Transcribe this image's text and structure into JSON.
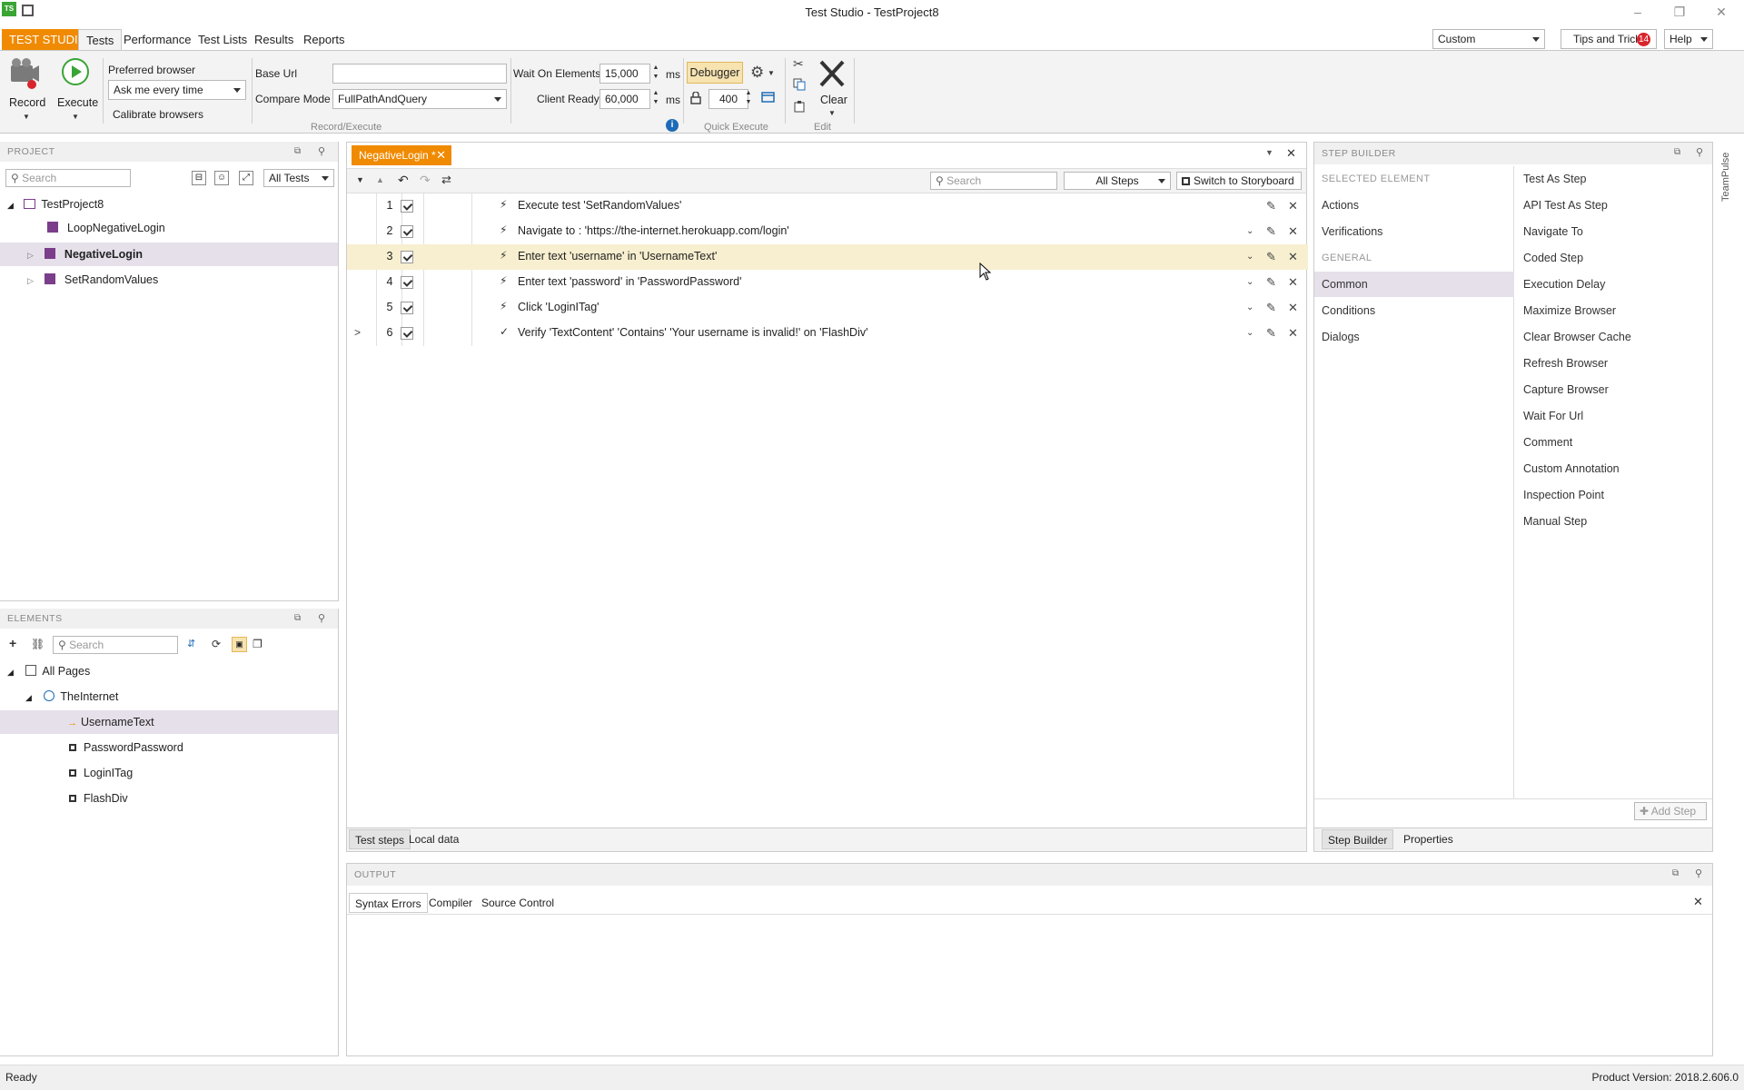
{
  "app": {
    "title": "Test Studio - TestProject8",
    "logo": "TS"
  },
  "ribbon_tabs": [
    "TEST STUDIO",
    "Tests",
    "Performance",
    "Test Lists",
    "Results",
    "Reports"
  ],
  "ribbon_right": {
    "layout_select": "Custom",
    "tips": "Tips and Tricks",
    "tips_count": "14",
    "help": "Help"
  },
  "ribbon": {
    "record": "Record",
    "execute": "Execute",
    "preferred_browser": "Preferred browser",
    "browser_select": "Ask me every time",
    "calibrate": "Calibrate browsers",
    "base_url_label": "Base Url",
    "base_url_value": "",
    "compare_mode_label": "Compare Mode",
    "compare_mode_value": "FullPathAndQuery",
    "wait_label": "Wait On Elements",
    "wait_value": "15,000",
    "client_ready_label": "Client Ready",
    "client_ready_value": "60,000",
    "ms": "ms",
    "debugger": "Debugger",
    "quick_value": "400",
    "clear": "Clear",
    "group_record_execute": "Record/Execute",
    "group_quick_execute": "Quick Execute",
    "group_edit": "Edit"
  },
  "project": {
    "header": "PROJECT",
    "search_placeholder": "Search",
    "filter": "All Tests",
    "root": "TestProject8",
    "items": [
      "LoopNegativeLogin",
      "NegativeLogin",
      "SetRandomValues"
    ]
  },
  "elements": {
    "header": "ELEMENTS",
    "search_placeholder": "Search",
    "root": "All Pages",
    "page": "TheInternet",
    "items": [
      "UsernameText",
      "PasswordPassword",
      "LoginITag",
      "FlashDiv"
    ]
  },
  "editor": {
    "tab": "NegativeLogin *",
    "search_placeholder": "Search",
    "filter": "All Steps",
    "storyboard": "Switch to Storyboard",
    "steps": [
      {
        "num": "1",
        "text": "Execute test 'SetRandomValues'"
      },
      {
        "num": "2",
        "text": "Navigate to : 'https://the-internet.herokuapp.com/login'"
      },
      {
        "num": "3",
        "text": "Enter text 'username' in 'UsernameText'"
      },
      {
        "num": "4",
        "text": "Enter text 'password' in 'PasswordPassword'"
      },
      {
        "num": "5",
        "text": "Click 'LoginITag'"
      },
      {
        "num": "6",
        "text": "Verify 'TextContent' 'Contains' 'Your username is invalid!' on 'FlashDiv'"
      }
    ],
    "bottom_tabs": [
      "Test steps",
      "Local data"
    ]
  },
  "step_builder": {
    "header": "STEP BUILDER",
    "selected_element": "SELECTED ELEMENT",
    "categories_a": [
      "Actions",
      "Verifications"
    ],
    "general": "GENERAL",
    "categories_b": [
      "Common",
      "Conditions",
      "Dialogs"
    ],
    "items": [
      "Test As Step",
      "API Test As Step",
      "Navigate To",
      "Coded Step",
      "Execution Delay",
      "Maximize Browser",
      "Clear Browser Cache",
      "Refresh Browser",
      "Capture Browser",
      "Wait For Url",
      "Comment",
      "Custom Annotation",
      "Inspection Point",
      "Manual Step"
    ],
    "add_step": "Add Step",
    "bottom_tabs": [
      "Step Builder",
      "Properties"
    ],
    "side_tab": "TeamPulse"
  },
  "output": {
    "header": "OUTPUT",
    "tabs": [
      "Syntax Errors",
      "Compiler",
      "Source Control"
    ]
  },
  "status": {
    "left": "Ready",
    "right": "Product Version: 2018.2.606.0"
  },
  "colors": {
    "brand": "#f08a00",
    "selected_row": "#f7efcf",
    "selected_tree": "#e6e0ea",
    "tips_badge": "#d9242b"
  }
}
